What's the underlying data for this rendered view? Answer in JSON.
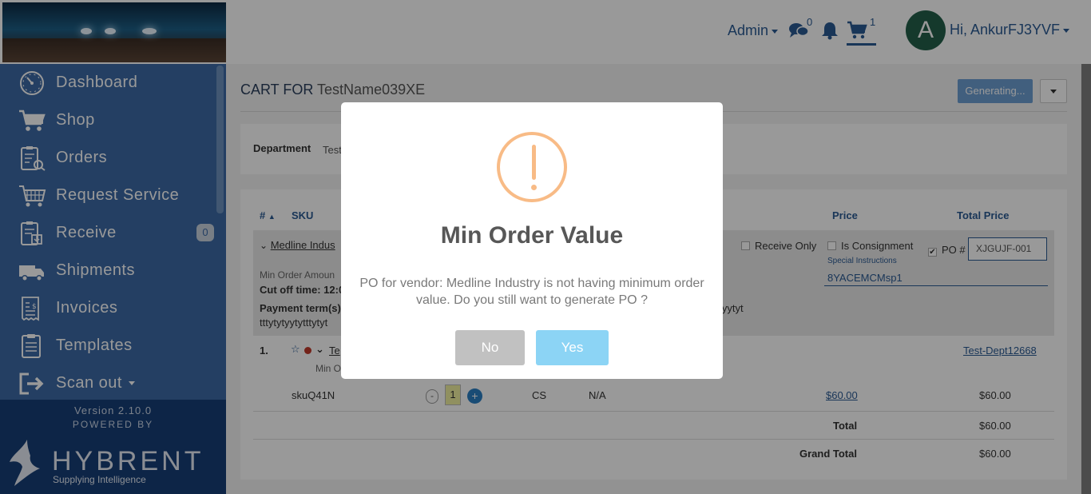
{
  "header": {
    "admin_label": "Admin",
    "messages_count": "0",
    "cart_count": "1",
    "avatar_initial": "A",
    "user_greeting": "Hi, AnkurFJ3YVF"
  },
  "sidebar": {
    "items": [
      {
        "label": "Dashboard",
        "icon": "dashboard-icon"
      },
      {
        "label": "Shop",
        "icon": "cart-icon"
      },
      {
        "label": "Orders",
        "icon": "orders-icon"
      },
      {
        "label": "Request Service",
        "icon": "service-icon"
      },
      {
        "label": "Receive",
        "icon": "receive-icon",
        "badge": "0"
      },
      {
        "label": "Shipments",
        "icon": "truck-icon"
      },
      {
        "label": "Invoices",
        "icon": "invoice-icon"
      },
      {
        "label": "Templates",
        "icon": "clipboard-icon"
      },
      {
        "label": "Scan out",
        "icon": "exit-icon"
      }
    ],
    "version": "Version 2.10.0",
    "powered_by": "POWERED BY",
    "brand": "HYBRENT",
    "tagline": "Supplying Intelligence"
  },
  "page": {
    "title_prefix": "CART FOR",
    "title_name": "TestName039XE",
    "generate_button": "Generating...",
    "department_label": "Department",
    "department_value": "Test"
  },
  "table": {
    "headers": {
      "num": "#",
      "sku": "SKU",
      "price": "Price",
      "total_price": "Total Price"
    },
    "vendor": {
      "name": "Medline Indus",
      "min_order_amount": "Min Order Amoun",
      "cut_off": "Cut off time: 12:0",
      "payment_terms": "Payment term(s)",
      "payment_tail_1": "tytytyytyt",
      "payment_line_2": "tttytytyytytttytyt",
      "receive_only": "Receive Only",
      "is_consignment": "Is Consignment",
      "po_label": "PO #",
      "po_value": "XJGUJF-001",
      "special_instructions_label": "Special Instructions",
      "special_instructions_value": "8YACEMCMsp1"
    },
    "item": {
      "index": "1.",
      "name_fragment": "Te",
      "min_fragment": "Min O",
      "department_link": "Test-Dept12668",
      "sku": "skuQ41N",
      "qty_minus": "-",
      "qty": "1",
      "qty_plus": "+",
      "uom": "CS",
      "na": "N/A",
      "price": "$60.00",
      "total": "$60.00"
    },
    "total_label": "Total",
    "total_value": "$60.00",
    "grand_total_label": "Grand Total",
    "grand_total_value": "$60.00"
  },
  "modal": {
    "title": "Min Order Value",
    "message": "PO for vendor: Medline Industry is not having minimum order value. Do you still want to generate PO ?",
    "no_label": "No",
    "yes_label": "Yes",
    "warning_color": "#f8bb86",
    "confirm_color": "#8cd4f5"
  }
}
